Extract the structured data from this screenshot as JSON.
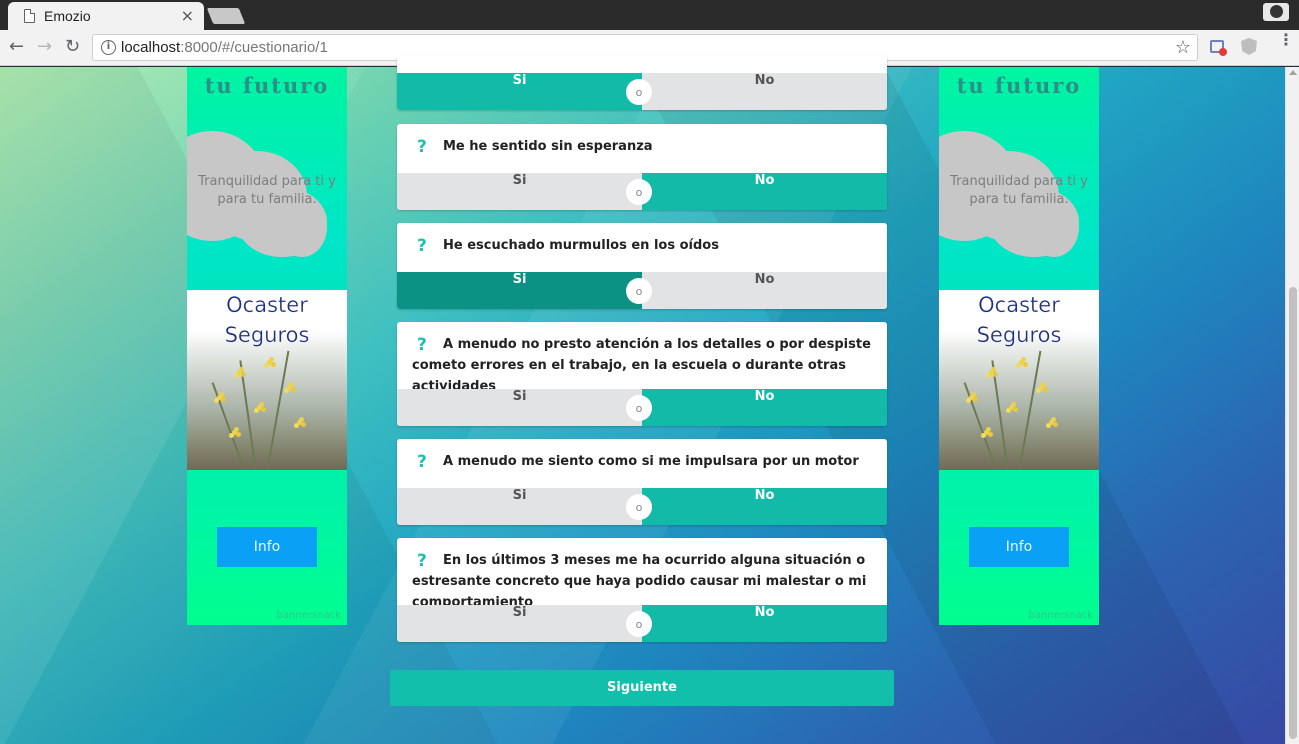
{
  "browser": {
    "tab_title": "Emozio",
    "tab_close": "×",
    "url_host": "localhost",
    "url_path": ":8000/#/cuestionario/1",
    "back_glyph": "←",
    "forward_glyph": "→",
    "reload_glyph": "↻",
    "star_glyph": "☆",
    "menu_glyph": "⋮"
  },
  "ads": {
    "title": "tu futuro",
    "tagline": "Tranquilidad para ti y para tu familia.",
    "brand_line1": "Ocaster",
    "brand_line2": "Seguros",
    "button_label": "Info",
    "credit": "bannersnack"
  },
  "questionnaire": {
    "or_label": "o",
    "yes_label": "Si",
    "no_label": "No",
    "questions": [
      {
        "text": "",
        "answer": "Si"
      },
      {
        "text": "Me he sentido sin esperanza",
        "answer": "No"
      },
      {
        "text": "He escuchado murmullos en los oídos",
        "answer": "Si"
      },
      {
        "text": "A menudo no presto atención a los detalles o por despiste cometo errores en el trabajo, en la escuela o durante otras actividades",
        "answer": "No"
      },
      {
        "text": "A menudo me siento como si me impulsara por un motor",
        "answer": "No"
      },
      {
        "text": "En los últimos 3 meses me ha ocurrido alguna situación o estresante concreto que haya podido causar mi malestar o mi comportamiento",
        "answer": "No"
      }
    ],
    "next_label": "Siguiente"
  },
  "colors": {
    "accent": "#11bba8",
    "accent_hover": "#0b9285",
    "inactive": "#e1e3e5",
    "ad_button": "#0aa0f5",
    "question_mark": "#1fbfb0"
  }
}
